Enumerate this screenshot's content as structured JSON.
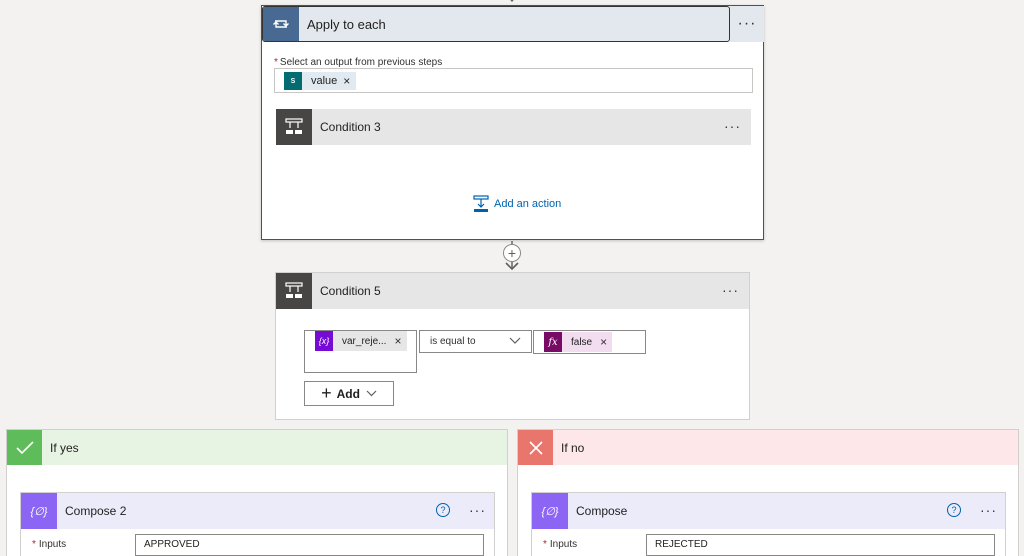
{
  "apply_to_each": {
    "title": "Apply to each",
    "more": "···",
    "field_label": "Select an output from previous steps",
    "required_mark": "*",
    "token": {
      "icon_text": "S",
      "label": "value",
      "remove": "×"
    },
    "inner_condition": {
      "title": "Condition 3",
      "more": "···"
    },
    "add_action": "Add an action"
  },
  "connector": {
    "plus": "+"
  },
  "condition5": {
    "title": "Condition 5",
    "more": "···",
    "left_token": {
      "icon_text": "{x}",
      "label": "var_reje...",
      "remove": "×"
    },
    "operator": "is equal to",
    "right_token": {
      "icon_text": "fx",
      "label": "false",
      "remove": "×"
    },
    "add_button": "Add"
  },
  "branch_yes": {
    "title": "If yes",
    "compose": {
      "title": "Compose 2",
      "help": "?",
      "more": "···",
      "inputs_label": "Inputs",
      "required_mark": "*",
      "inputs_value": "APPROVED"
    }
  },
  "branch_no": {
    "title": "If no",
    "compose": {
      "title": "Compose",
      "help": "?",
      "more": "···",
      "inputs_label": "Inputs",
      "required_mark": "*",
      "inputs_value": "REJECTED"
    }
  },
  "colors": {
    "loop_icon": "#486991",
    "condition_icon": "#484644",
    "variable_icon": "#770bd6",
    "expression_icon": "#770b65",
    "compose_icon": "#8d65f5",
    "yes_green": "#5fbc5a",
    "no_red": "#e8766d",
    "link_blue": "#0062ad"
  }
}
